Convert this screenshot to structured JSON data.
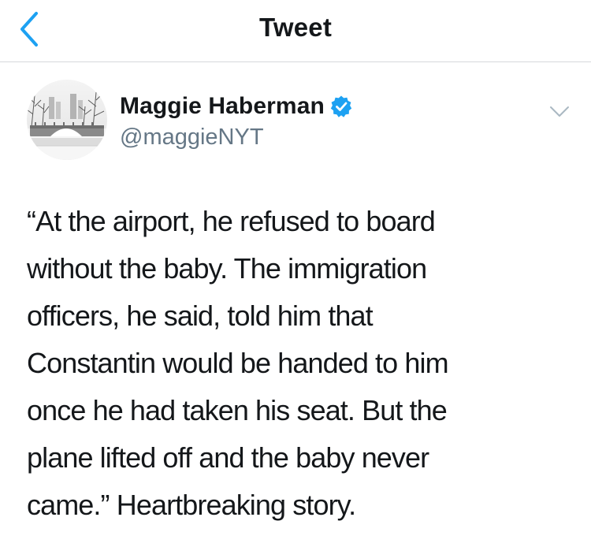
{
  "header": {
    "title": "Tweet",
    "back_icon": "chevron-left-icon",
    "accent_color": "#1da1f2"
  },
  "tweet": {
    "author": {
      "display_name": "Maggie Haberman",
      "handle": "@maggieNYT",
      "verified": true,
      "verified_icon": "verified-badge-icon",
      "avatar": "snowy-park-bridge-photo"
    },
    "more_icon": "chevron-down-icon",
    "text": "“At the airport, he refused to board\nwithout the baby. The immigration\nofficers, he said, told him that\nConstantin would be handed to him\nonce he had taken his seat. But the\nplane lifted off and the baby never\ncame.” Heartbreaking story."
  },
  "colors": {
    "primary_text": "#14171a",
    "secondary_text": "#657786",
    "divider": "#d6d9dc",
    "verified_blue": "#1da1f2"
  }
}
